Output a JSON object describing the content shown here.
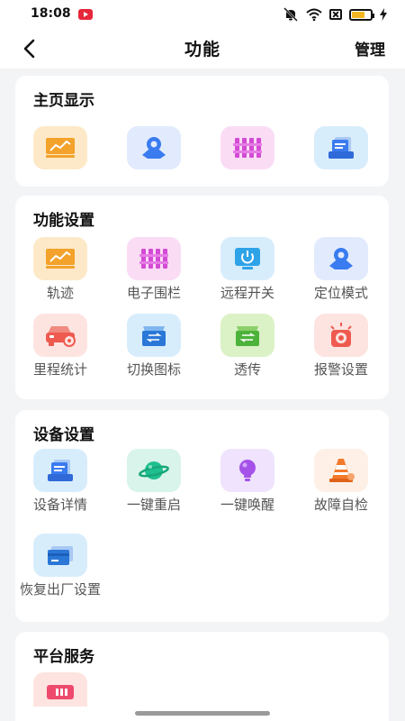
{
  "status_bar": {
    "time": "18:08",
    "battery_percent": 70
  },
  "header": {
    "title": "功能",
    "manage_label": "管理"
  },
  "sections": {
    "home": {
      "title": "主页显示"
    },
    "function": {
      "title": "功能设置",
      "items": [
        "轨迹",
        "电子围栏",
        "远程开关",
        "定位模式",
        "里程统计",
        "切换图标",
        "透传",
        "报警设置"
      ]
    },
    "device": {
      "title": "设备设置",
      "items": [
        "设备详情",
        "一键重启",
        "一键唤醒",
        "故障自检",
        "恢复出厂设置"
      ]
    },
    "platform": {
      "title": "平台服务"
    }
  },
  "icons": {
    "home": [
      "track-icon",
      "location-icon",
      "fence-icon",
      "device-detail-icon"
    ],
    "function": [
      "track-icon",
      "fence-icon",
      "power-icon",
      "location-icon",
      "car-icon",
      "switch-icon",
      "transfer-icon",
      "alarm-icon"
    ],
    "device": [
      "device-detail-icon",
      "planet-icon",
      "bulb-icon",
      "cone-icon",
      "card-icon"
    ],
    "platform": [
      "sim-card-icon"
    ]
  },
  "colors": {
    "accent_orange": "#f3a22b",
    "accent_blue": "#3a7bf0",
    "accent_pink": "#d34bd4",
    "accent_red": "#ee5a4f",
    "accent_green": "#4cb33a"
  }
}
